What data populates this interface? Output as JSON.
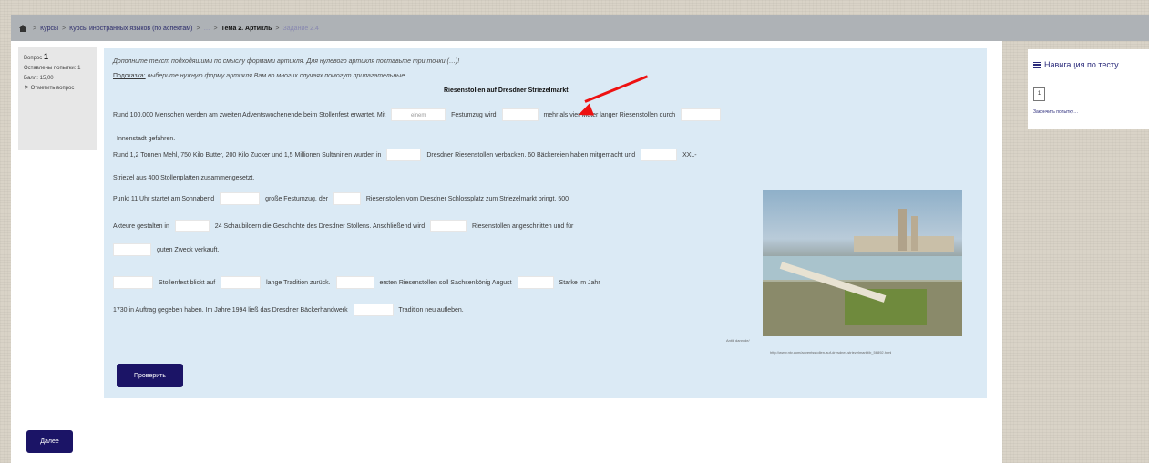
{
  "breadcrumb": {
    "home_icon": "home-icon",
    "items": [
      "Курсы",
      "Курсы иностранных языков (по аспектам)",
      "…",
      "Тема 2. Артикль",
      "Задание 2.4"
    ],
    "separator": ">"
  },
  "question_info": {
    "label": "Вопрос",
    "number": "1",
    "status": "Оставлены попытки: 1",
    "score": "Балл: 15,00",
    "flag": "Отметить вопрос"
  },
  "content": {
    "instruction": "Дополните текст подходящими по смыслу формами артикля. Для нулевого артикля поставьте три точки (…)!",
    "hint_label": "Подсказка:",
    "hint_text": "выберите нужную форму артикля Вам во многих случаях помогут прилагательные.",
    "title": "Riesenstollen auf Dresdner Striezelmarkt",
    "line1a": "Rund 100.000 Menschen werden am zweiten Adventswochenende beim Stollenfest erwartet. Mit",
    "gap1_value": "einem",
    "line1b": "Festumzug wird",
    "line1c": "mehr als vier Meter langer Riesenstollen durch",
    "line2": "Innenstadt gefahren.",
    "line3a": "Rund 1,2 Tonnen Mehl, 750 Kilo Butter, 200 Kilo Zucker und 1,5 Millionen Sultaninen wurden in",
    "line3b": "Dresdner Riesenstollen verbacken. 60 Bäckereien haben mitgemacht und",
    "line3c": "XXL-",
    "line4": "Striezel aus 400 Stollenplatten zusammengesetzt.",
    "line5a": "Punkt 11 Uhr startet am Sonnabend",
    "line5b": "große Festumzug, der",
    "line5c": "Riesenstollen vom Dresdner Schlossplatz zum Striezelmarkt bringt. 500",
    "line6a": "Akteure gestalten in",
    "line6b": "24 Schaubildern die Geschichte des Dresdner Stollens. Anschließend wird",
    "line6c": "Riesenstollen angeschnitten und für",
    "line7": "guten Zweck verkauft.",
    "line8a": "Stollenfest blickt auf",
    "line8b": "lange Tradition zurück.",
    "line8c": "ersten Riesenstollen soll Sachsenkönig August",
    "line8d": "Starke im Jahr",
    "line9a": "1730 in Auftrag gegeben haben. Im Jahre 1994 ließ das Dresdner Bäckerhandwerk",
    "line9b": "Tradition neu aufleben.",
    "caption1": "Antik dann.de/",
    "caption2": "http://www.ntv.com/adventsstollen-auf-dresdner-striezelmarkt/b_56892.html"
  },
  "buttons": {
    "check": "Проверить",
    "next": "Далее"
  },
  "navigation": {
    "menu_icon": "menu-icon",
    "title": "Навигация по тесту",
    "question_number": "1",
    "finish": "Закончить попытку…"
  },
  "colors": {
    "button_bg": "#1b1466",
    "content_bg": "#dbeaf5",
    "topbar_bg": "#aeb2b6",
    "annotation_arrow": "#e11111"
  }
}
